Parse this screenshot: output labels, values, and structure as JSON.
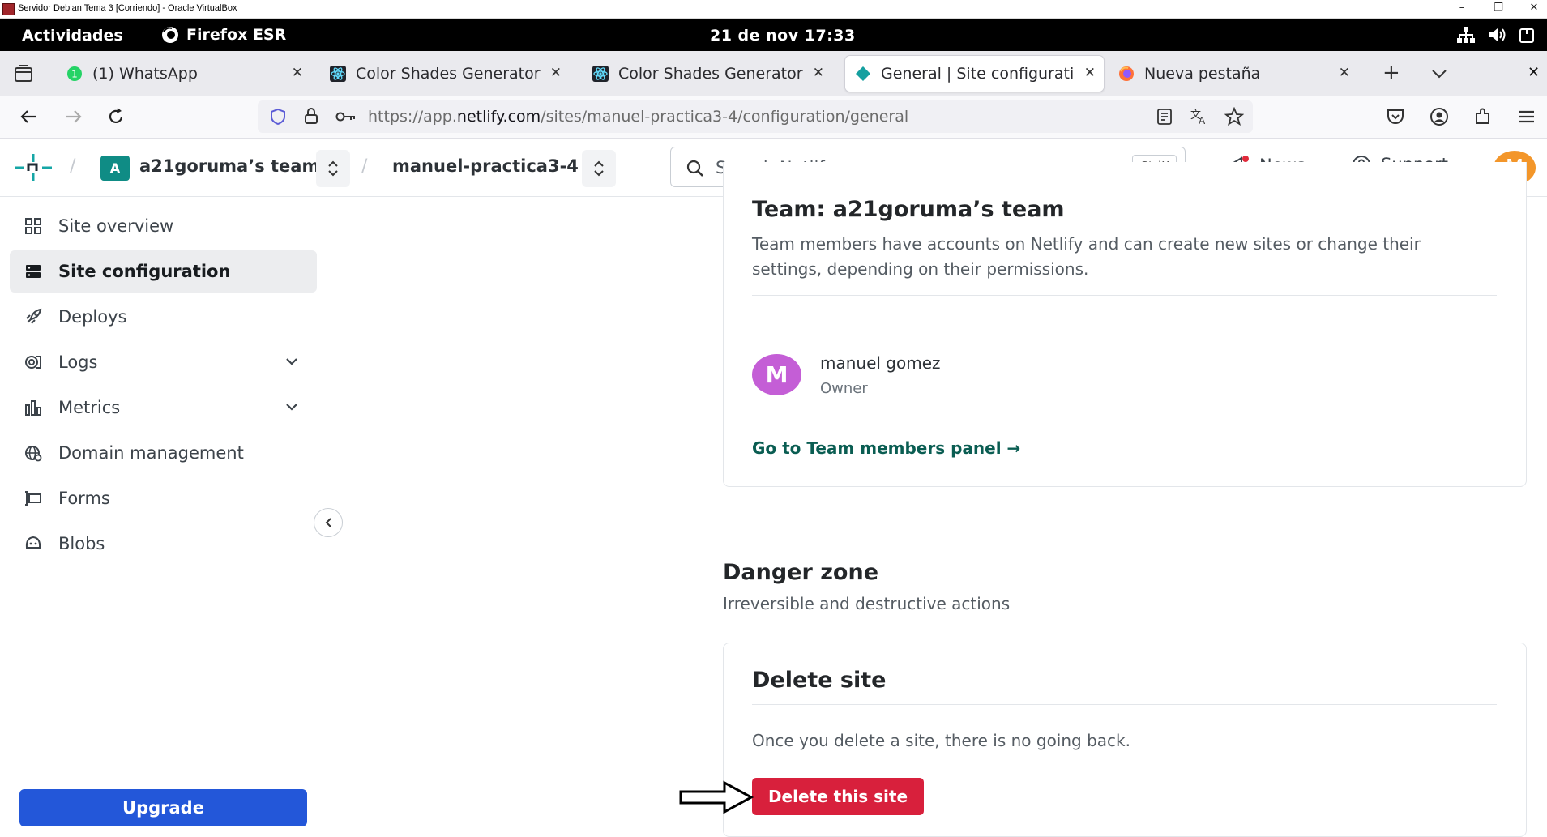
{
  "vbox": {
    "title": "Servidor Debian Tema 3 [Corriendo] - Oracle VirtualBox",
    "controls": [
      "–",
      "❐",
      "✕"
    ]
  },
  "gnome": {
    "activities": "Actividades",
    "app_name": "Firefox ESR",
    "clock": "21 de nov  17:33"
  },
  "browser": {
    "tabs": [
      {
        "label": "(1) WhatsApp",
        "icon": "whatsapp-icon",
        "active": false
      },
      {
        "label": "Color Shades Generator",
        "icon": "react-icon",
        "active": false
      },
      {
        "label": "Color Shades Generator",
        "icon": "react-icon",
        "active": false
      },
      {
        "label": "General | Site configuration",
        "icon": "netlify-icon",
        "active": true
      },
      {
        "label": "Nueva pestaña",
        "icon": "firefox-icon",
        "active": false
      }
    ],
    "url_prefix": "https://app.",
    "url_domain": "netlify.com",
    "url_path": "/sites/manuel-practica3-4/configuration/general"
  },
  "header": {
    "team_badge": "A",
    "team_name": "a21goruma’s team",
    "site_name": "manuel-practica3-4",
    "search_placeholder": "Search Netlify...",
    "search_shortcut": "CtrlK",
    "news": "News",
    "support": "Support",
    "avatar_initial": "M"
  },
  "sidebar": {
    "items": [
      {
        "label": "Site overview",
        "icon": "grid-icon"
      },
      {
        "label": "Site configuration",
        "icon": "server-icon",
        "active": true
      },
      {
        "label": "Deploys",
        "icon": "rocket-icon"
      },
      {
        "label": "Logs",
        "icon": "logs-icon",
        "expandable": true
      },
      {
        "label": "Metrics",
        "icon": "bar-chart-icon",
        "expandable": true
      },
      {
        "label": "Domain management",
        "icon": "globe-icon"
      },
      {
        "label": "Forms",
        "icon": "forms-icon"
      },
      {
        "label": "Blobs",
        "icon": "blobs-icon"
      }
    ],
    "upgrade": "Upgrade"
  },
  "main": {
    "team_card": {
      "title": "Team: a21goruma’s team",
      "description": "Team members have accounts on Netlify and can create new sites or change their settings, depending on their permissions.",
      "member": {
        "initial": "M",
        "name": "manuel gomez",
        "role": "Owner"
      },
      "link": "Go to Team members panel →"
    },
    "danger_zone": {
      "title": "Danger zone",
      "subtitle": "Irreversible and destructive actions"
    },
    "delete_card": {
      "title": "Delete site",
      "description": "Once you delete a site, there is no going back.",
      "button": "Delete this site"
    }
  },
  "colors": {
    "netlify_teal": "#0f8c85",
    "danger_red": "#d8203c",
    "upgrade_blue": "#2357d9",
    "avatar_orange": "#f3962a",
    "member_avatar": "#c45ed6"
  }
}
